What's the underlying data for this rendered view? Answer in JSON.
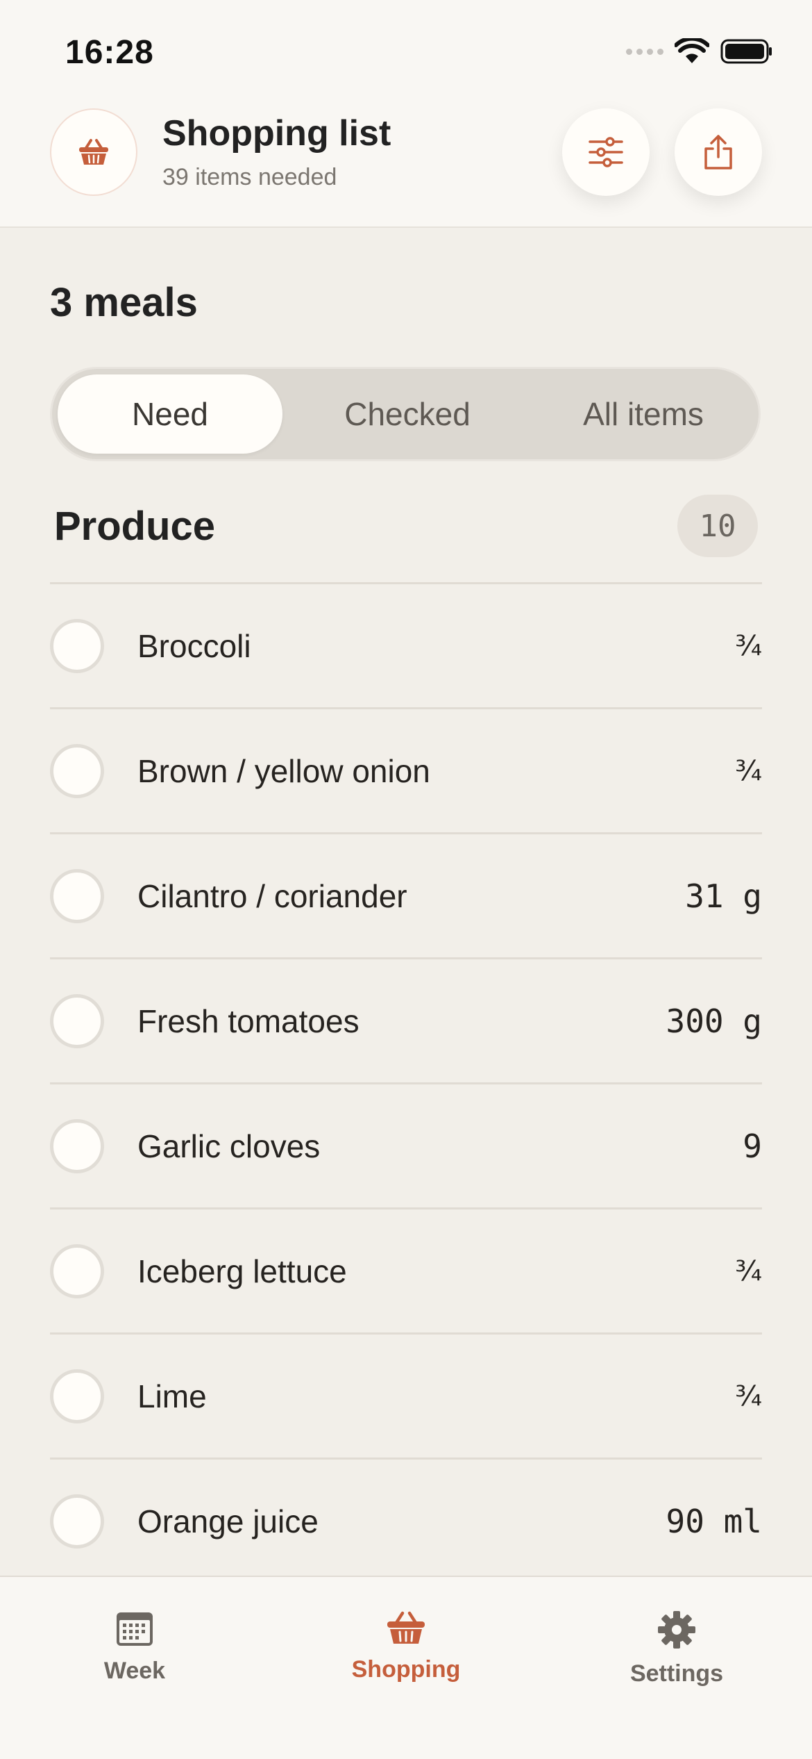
{
  "status_bar": {
    "time": "16:28"
  },
  "header": {
    "title": "Shopping list",
    "subtitle": "39 items needed",
    "app_icon": "basket-icon",
    "filter_icon": "sliders-icon",
    "share_icon": "share-icon"
  },
  "meals_heading": "3 meals",
  "tabs": [
    {
      "label": "Need",
      "active": true
    },
    {
      "label": "Checked",
      "active": false
    },
    {
      "label": "All items",
      "active": false
    }
  ],
  "section": {
    "title": "Produce",
    "count": "10"
  },
  "items": [
    {
      "name": "Broccoli",
      "qty": "¾"
    },
    {
      "name": "Brown / yellow onion",
      "qty": "¾"
    },
    {
      "name": "Cilantro / coriander",
      "qty": "31 g"
    },
    {
      "name": "Fresh tomatoes",
      "qty": "300 g"
    },
    {
      "name": "Garlic cloves",
      "qty": "9"
    },
    {
      "name": "Iceberg lettuce",
      "qty": "¾"
    },
    {
      "name": "Lime",
      "qty": "¾"
    },
    {
      "name": "Orange juice",
      "qty": "90 ml"
    }
  ],
  "bottom_nav": [
    {
      "label": "Week",
      "icon": "calendar-icon",
      "active": false
    },
    {
      "label": "Shopping",
      "icon": "basket-icon",
      "active": true
    },
    {
      "label": "Settings",
      "icon": "gear-icon",
      "active": false
    }
  ],
  "colors": {
    "accent": "#c55e3b",
    "background": "#f2efe9",
    "surface": "#f9f7f3"
  }
}
